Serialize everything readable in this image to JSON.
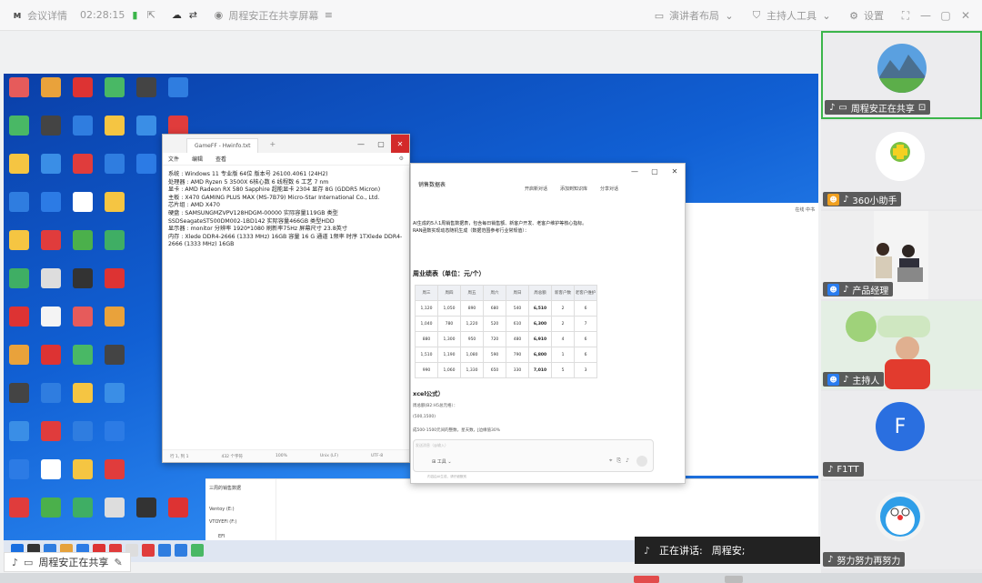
{
  "topbar": {
    "meeting_details": "会议详情",
    "timer": "02:28:15",
    "sharing_title": "周程安正在共享屏幕",
    "speaker_layout": "演讲者布局",
    "host_tools": "主持人工具",
    "settings": "设置"
  },
  "notepad": {
    "tab": "GameFF - Hwinfo.txt",
    "menu": [
      "文件",
      "编辑",
      "查看"
    ],
    "lines": [
      "系统 : Windows 11 专业版 64位 版本号 26100.4061 (24H2)",
      "处理器 : AMD Ryzen 5 3500X 6核心数 6 线程数 6 工艺 7 nm",
      "显卡 : AMD Radeon RX 580 Sapphire 超能显卡 2304 显存 8G (GDDR5 Micron)",
      "主板 : X470 GAMING PLUS MAX (MS-7B79) Micro-Star International Co., Ltd.",
      "芯片组 : AMD X470",
      "硬盘 : SAMSUNGMZVPV128HDGM-00000 实际容量119GB 类型SSDSeagateST500DM002-1BD142 实际容量466GB 类型HDD",
      "显示器 : monitor 分辨率 1920*1080 刷新率75Hz 屏幕尺寸 23.8英寸",
      "内存 : Xlede DDR4-2666 (1333 MHz) 16GB 容量 16 G 通道 1频率 时序 1TXlede DDR4-2666 (1333 MHz) 16GB"
    ],
    "status": [
      "行 1, 列 1",
      "432 个字符",
      "100%",
      "Unix (LF)",
      "UTF-8"
    ]
  },
  "aiwin": {
    "title": "销售数据表",
    "btn_share": "开启新对话",
    "btn_add": "添加到知识库",
    "btn_share2": "分享对话",
    "text1": "AI生成的5人1周销售数据表，包含每日销售额、新客户开发、老客户维护等核心指标。",
    "text2": "RAN函数实现动态随机生成（数据范围参考行业常规值）：",
    "table_title": "周业绩表（单位：元/个）",
    "table_head": [
      "周三",
      "周四",
      "周五",
      "周六",
      "周日",
      "周总额",
      "新客户数",
      "老客户维护"
    ],
    "table_rows": [
      [
        "1,120",
        "1,050",
        "890",
        "680",
        "540",
        "6,510",
        "2",
        "6"
      ],
      [
        "1,040",
        "780",
        "1,220",
        "520",
        "610",
        "6,300",
        "2",
        "7"
      ],
      [
        "880",
        "1,300",
        "950",
        "720",
        "480",
        "6,910",
        "4",
        "6"
      ],
      [
        "1,510",
        "1,190",
        "1,080",
        "590",
        "790",
        "6,800",
        "1",
        "6"
      ],
      [
        "990",
        "1,060",
        "1,330",
        "650",
        "330",
        "7,010",
        "5",
        "3"
      ]
    ],
    "formula_title": "xcel公式）",
    "formula1": "周总额(B2:H5总元格）：",
    "formula2": "(500,1500)",
    "formula3": "成500-1500元间的整数，星天数，J边缘值30%",
    "input_placeholder": "发送消息（@输入）",
    "tools": "工具",
    "footer": "内容由AI生成，请仔细甄别"
  },
  "explorer": {
    "rows": [
      "三周的销售数据",
      "Ventoy (E:)",
      "VTOYEFI (F:)",
      "EFI"
    ]
  },
  "bg_hint": "在线 中书",
  "share_label": "周程安正在共享",
  "speaking": {
    "label": "正在讲话:",
    "name": "周程安;"
  },
  "participants": [
    {
      "name": "周程安正在共享",
      "role": ""
    },
    {
      "name": "360小助手",
      "role": "assistant"
    },
    {
      "name": "产品经理",
      "role": "member"
    },
    {
      "name": "主持人",
      "role": "host"
    },
    {
      "name": "F1TT",
      "role": "",
      "initial": "F"
    },
    {
      "name": "努力努力再努力",
      "role": ""
    }
  ],
  "colors": {
    "accent_green": "#3bb54a",
    "avatar_blue": "#2a6fe0",
    "close_red": "#d32a2a"
  }
}
